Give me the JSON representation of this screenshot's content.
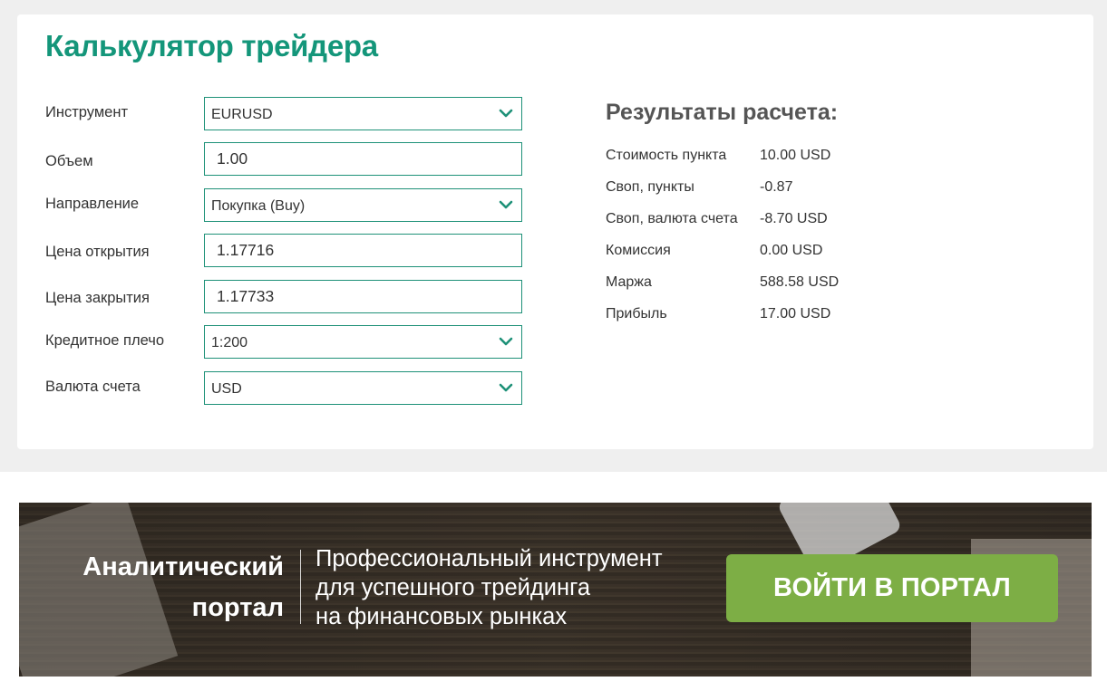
{
  "calculator": {
    "title": "Калькулятор трейдера",
    "fields": [
      {
        "label": "Инструмент",
        "type": "select",
        "value": "EURUSD"
      },
      {
        "label": "Объем",
        "type": "input",
        "value": "1.00"
      },
      {
        "label": "Направление",
        "type": "select",
        "value": "Покупка (Buy)"
      },
      {
        "label": "Цена открытия",
        "type": "input",
        "value": "1.17716"
      },
      {
        "label": "Цена закрытия",
        "type": "input",
        "value": "1.17733"
      },
      {
        "label": "Кредитное плечо",
        "type": "select",
        "value": "1:200"
      },
      {
        "label": "Валюта счета",
        "type": "select",
        "value": "USD"
      }
    ]
  },
  "results": {
    "title": "Результаты расчета:",
    "rows": [
      {
        "key": "Стоимость пункта",
        "value": "10.00 USD"
      },
      {
        "key": "Своп, пункты",
        "value": "-0.87"
      },
      {
        "key": "Своп, валюта счета",
        "value": "-8.70 USD"
      },
      {
        "key": "Комиссия",
        "value": "0.00 USD"
      },
      {
        "key": "Маржа",
        "value": "588.58 USD"
      },
      {
        "key": "Прибыль",
        "value": "17.00 USD"
      }
    ]
  },
  "banner": {
    "left_line1": "Аналитический",
    "left_line2": "портал",
    "text_line1": "Профессиональный инструмент",
    "text_line2": "для успешного трейдинга",
    "text_line3": "на финансовых рынках",
    "button_label": "ВОЙТИ В ПОРТАЛ"
  },
  "colors": {
    "accent": "#14967a",
    "field_border": "#1e9178",
    "button": "#7dae45"
  },
  "icons": {
    "select_chevron": "chevron-down-icon"
  }
}
